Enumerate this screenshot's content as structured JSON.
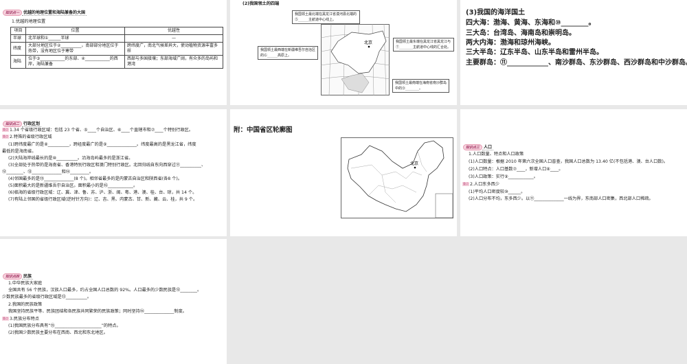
{
  "slide1": {
    "tag": "知识点一",
    "title": "优越的地理位置和海陆兼备的大国",
    "sub": "1.优越的地理位置",
    "headers": [
      "项目",
      "位置",
      "优越性"
    ],
    "rows": [
      [
        "半球",
        "北半球和①______半球",
        "—"
      ],
      [
        "纬度",
        "大部分地区位于②__________，南部部分地区位于热带，没有地区位于寒带",
        "跨纬度广，南北气候差异大，使动植物资源丰富多样"
      ],
      [
        "海陆",
        "位于③____________的东部、④____________的西岸，海陆兼备",
        "西部与多国接壤；东部海域广阔，有众多的岛屿和港湾"
      ]
    ]
  },
  "slide2": {
    "heading": "(2)我国领土的四端",
    "north": "我国领土最北端在黑龙江省漠河县北端的⑤______主航道中心线上。",
    "west": "我国领土最西端在新疆维吾尔自治区的⑥______高原上。",
    "east": "我国领土最东端在黑龙江省黑龙江与⑦________主航道中心线的汇合处。",
    "south": "我国领土最南端在海南省南沙群岛中的⑨________。",
    "beijing": "北京"
  },
  "slide3": {
    "lines": [
      "(3)我国的海洋国土",
      "四大海：渤海、黄海、东海和⑩________。",
      "三大岛：台湾岛、海南岛和崇明岛。",
      "两大内海：渤海和琼州海峡。",
      "三大半岛：辽东半岛、山东半岛和雷州半岛。",
      "主要群岛：⑪____________、南沙群岛、东沙群岛、西沙群岛和中沙群岛。"
    ]
  },
  "slide4": {
    "tag": "知识点二",
    "title": "行政区划",
    "mark": "重点",
    "lines": [
      "1.34 个省级行政区域：包括 23 个省、⑤____个自治区、⑥____个直辖市和⑦____个特别行政区。",
      "2.特殊的省级行政区域",
      "(1)跨纬度最广的是⑧__________，跨经度最广的是⑨______________。纬度最高的是黑龙江省，纬度",
      "最低的是海南省。",
      "(2)大陆海岸线最长的是⑩__________。沿海岛屿最多的是浙江省。",
      "(3)全部处于热带的是海南省、香港特别行政区和澳门特别行政区。北回归线自东向西穿过⑪__________、",
      "⑫________、⑬______________和⑭_________。",
      "(4)邻国最多的是⑮______________(8 个)。相邻省最多的是内蒙古自治区和陕西省(各8 个)。",
      "(5)面积最大的是新疆维吾尔自治区。面积最小的是⑯____________。",
      "(6)临海的省级行政区域：辽、冀、津、鲁、苏、沪、浙、闽、粤、港、澳、桂、台、琼，共 14 个。",
      "(7)有陆上邻国的省级行政区域(逆时针方向)：辽、吉、黑、内蒙古、甘、新、藏、云、桂，共 9 个。"
    ]
  },
  "slide5": {
    "title": "附：中国省区轮廓图",
    "beijing": "北京"
  },
  "slide6": {
    "tag": "知识点三",
    "title": "人口",
    "mark": "重点",
    "lines": [
      "1.人口数量、特点和人口政策",
      "(1)人口数量：根据 2010 年第六次全国人口普查，我国人口总数为 13.40 亿(不包括港、澳、台人口数)。",
      "(2)人口特点：人口基数⑦____，新增人口⑧____。",
      "(3)人口政策：实行⑨____________。",
      "2.人口东多西少",
      "(1)平均人口密度较⑩______。",
      "(2)人口分布不均，东多西少。以⑪______________一线为界，东南部人口密集，西北部人口稀疏。"
    ]
  },
  "slide7": {
    "tag": "知识点四",
    "title": "民族",
    "mark": "重点",
    "lines": [
      "1.中华民族大家庭",
      "全国共有 56 个民族，汉族人口最多，约占全国人口总数的 92%。人口最多的少数民族是⑫________。",
      "少数民族最多的省级行政区域是⑬__________。",
      "2.我国的民族政策",
      "我国坚持民族平等、民族团结和各民族共同繁荣的民族政策；同时坚持⑭______________制度。",
      "3.民族分布特点",
      "(1)我国民族分布具有“⑮______________________”的特点。",
      "(2)我国少数民族主要分布在西南、西北和东北地区。"
    ]
  }
}
